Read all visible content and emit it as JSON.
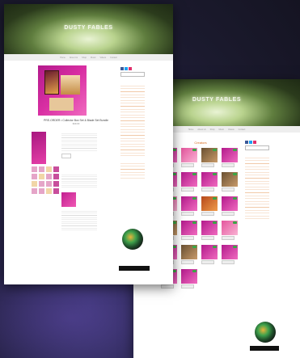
{
  "brand": "DUSTY FABLES",
  "nav": [
    "Home",
    "About Us",
    "Shop",
    "Music",
    "Videos",
    "Contact"
  ],
  "product": {
    "title": "PRE-ORDER • Collector Box Set & Blade Set Bundle",
    "price": "$49.00"
  },
  "shop": {
    "title": "Creators"
  },
  "colors": {
    "accent": "#d86a1c",
    "pink": "#d92fa3",
    "badge": "#3aa645"
  }
}
